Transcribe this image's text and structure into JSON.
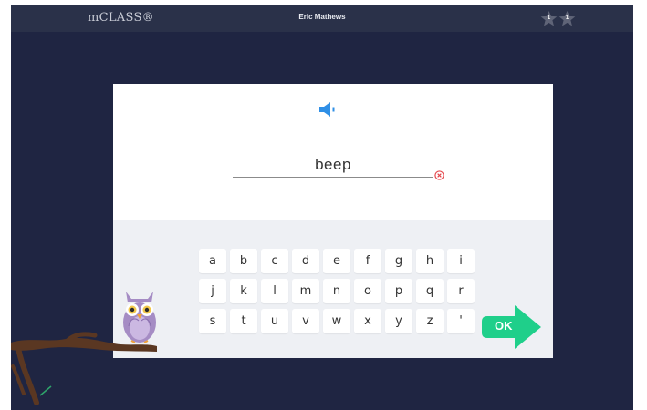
{
  "header": {
    "brand": "mCLASS®",
    "user_name": "Eric Mathews",
    "stars": [
      {
        "icon": "star-icon",
        "label": "1"
      },
      {
        "icon": "star-icon",
        "label": "1"
      }
    ]
  },
  "prompt": {
    "audio_icon": "speaker-icon",
    "answer_value": "beep",
    "clear_icon": "clear-icon"
  },
  "keyboard": {
    "rows": [
      [
        "a",
        "b",
        "c",
        "d",
        "e",
        "f",
        "g",
        "h",
        "i"
      ],
      [
        "j",
        "k",
        "l",
        "m",
        "n",
        "o",
        "p",
        "q",
        "r"
      ],
      [
        "s",
        "t",
        "u",
        "v",
        "w",
        "x",
        "y",
        "z",
        "'"
      ]
    ],
    "ok_label": "OK"
  },
  "colors": {
    "background": "#1f2542",
    "topbar": "#2a3149",
    "speaker": "#2f8fe6",
    "ok_button": "#1fcf8a",
    "clear_icon": "#e5454a",
    "owl": "#a58cc4"
  }
}
